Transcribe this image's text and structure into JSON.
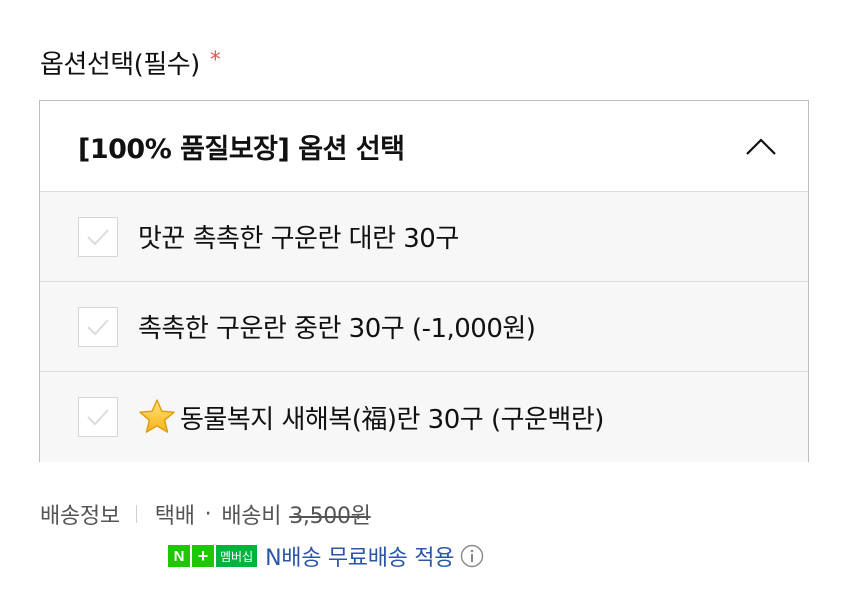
{
  "option_section": {
    "title": "옵션선택(필수)",
    "required_mark": "*",
    "dropdown_label": "[100% 품질보장] 옵션 선택",
    "chevron_icon": "chevron-up-icon",
    "items": [
      {
        "label": "맛꾼 촉촉한 구운란 대란 30구",
        "checked": false
      },
      {
        "label": "촉촉한 구운란 중란 30구 (-1,000원)",
        "checked": false
      },
      {
        "label": "동물복지 새해복(福)란 30구 (구운백란)",
        "checked": false,
        "icon": "star-icon"
      }
    ]
  },
  "shipping": {
    "label": "배송정보",
    "method": "택배",
    "separator": "·",
    "fee_label": "배송비",
    "fee": "3,500원"
  },
  "membership": {
    "badge_n": "N",
    "badge_plus": "+",
    "badge_text": "멤버십",
    "text": "N배송 무료배송 적용",
    "info_icon": "info-icon"
  },
  "colors": {
    "required": "#e05a5a",
    "membership_text": "#2b56a8",
    "badge_green": "#1ec800",
    "row_background": "#f7f7f7",
    "border": "#bdbdbd"
  }
}
